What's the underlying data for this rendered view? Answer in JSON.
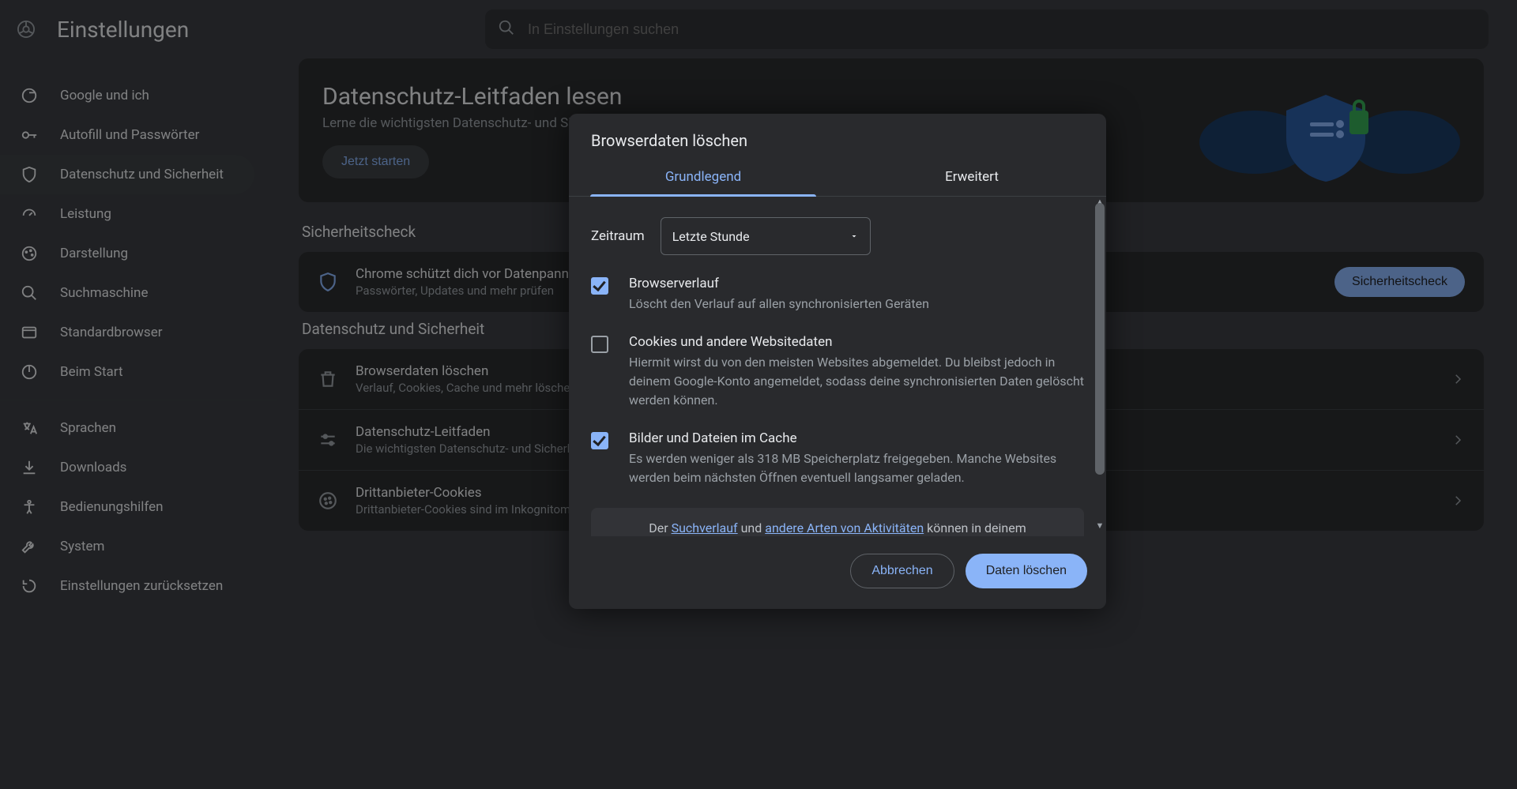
{
  "header": {
    "title": "Einstellungen",
    "search_placeholder": "In Einstellungen suchen"
  },
  "sidebar": {
    "items": [
      {
        "label": "Google und ich",
        "icon": "google"
      },
      {
        "label": "Autofill und Passwörter",
        "icon": "key"
      },
      {
        "label": "Datenschutz und Sicherheit",
        "icon": "shield",
        "active": true
      },
      {
        "label": "Leistung",
        "icon": "speed"
      },
      {
        "label": "Darstellung",
        "icon": "palette"
      },
      {
        "label": "Suchmaschine",
        "icon": "search"
      },
      {
        "label": "Standardbrowser",
        "icon": "browser"
      },
      {
        "label": "Beim Start",
        "icon": "power"
      }
    ],
    "more": [
      {
        "label": "Sprachen",
        "icon": "language"
      },
      {
        "label": "Downloads",
        "icon": "download"
      },
      {
        "label": "Bedienungshilfen",
        "icon": "accessibility"
      },
      {
        "label": "System",
        "icon": "wrench"
      },
      {
        "label": "Einstellungen zurücksetzen",
        "icon": "reset"
      }
    ]
  },
  "main": {
    "guide": {
      "title": "Datenschutz-Leitfaden lesen",
      "sub": "Lerne die wichtigsten Datenschutz- und Sicherheitseinstellungen kennen",
      "button": "Jetzt starten"
    },
    "security_section": "Sicherheitscheck",
    "security_row": {
      "title": "Chrome schützt dich vor Datenpannen, schädlichen Erweiterungen und mehr",
      "sub": "Passwörter, Updates und mehr prüfen",
      "button": "Sicherheitscheck"
    },
    "privacy_section": "Datenschutz und Sicherheit",
    "rows": [
      {
        "title": "Browserdaten löschen",
        "sub": "Verlauf, Cookies, Cache und mehr löschen"
      },
      {
        "title": "Datenschutz-Leitfaden",
        "sub": "Die wichtigsten Datenschutz- und Sicherheitseinstellungen prüfen"
      },
      {
        "title": "Drittanbieter-Cookies",
        "sub": "Drittanbieter-Cookies sind im Inkognitomodus blockiert"
      }
    ]
  },
  "modal": {
    "title": "Browserdaten löschen",
    "tabs": {
      "basic": "Grundlegend",
      "advanced": "Erweitert"
    },
    "time_label": "Zeitraum",
    "time_value": "Letzte Stunde",
    "items": [
      {
        "checked": true,
        "title": "Browserverlauf",
        "sub": "Löscht den Verlauf auf allen synchronisierten Geräten"
      },
      {
        "checked": false,
        "title": "Cookies und andere Websitedaten",
        "sub": "Hiermit wirst du von den meisten Websites abgemeldet. Du bleibst jedoch in deinem Google-Konto angemeldet, sodass deine synchronisierten Daten gelöscht werden können."
      },
      {
        "checked": true,
        "title": "Bilder und Dateien im Cache",
        "sub": "Es werden weniger als 318 MB Speicherplatz freigegeben. Manche Websites werden beim nächsten Öffnen eventuell langsamer geladen."
      }
    ],
    "note_pre": "Der ",
    "note_link1": "Suchverlauf",
    "note_mid": " und ",
    "note_link2": "andere Arten von Aktivitäten",
    "note_post": " können in deinem",
    "cancel": "Abbrechen",
    "confirm": "Daten löschen"
  }
}
